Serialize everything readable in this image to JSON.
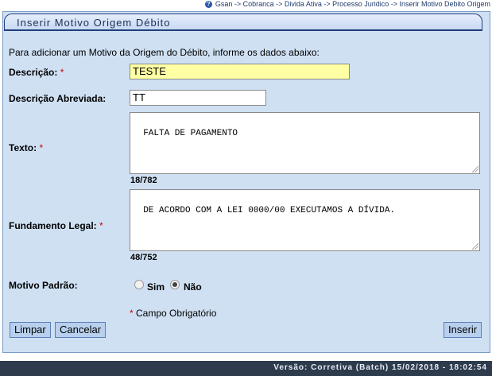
{
  "breadcrumb": "Gsan -> Cobranca -> Divida Ativa -> Processo Juridico -> Inserir Motivo Debito Origem",
  "panel": {
    "title": "Inserir Motivo Origem Débito",
    "intro": "Para adicionar um Motivo da Origem do Débito, informe os dados abaixo:"
  },
  "form": {
    "descricao_label": "Descrição:",
    "descricao_value": "TESTE",
    "descricao_abrev_label": "Descrição Abreviada:",
    "descricao_abrev_value": "TT",
    "texto_label": "Texto:",
    "texto_value": "FALTA DE PAGAMENTO",
    "texto_counter": "18/782",
    "fundamento_label": "Fundamento Legal:",
    "fundamento_value": "DE ACORDO COM A LEI 0000/00 EXECUTAMOS A DÍVIDA.",
    "fundamento_counter": "48/752",
    "motivo_label": "Motivo Padrão:",
    "opt_sim": "Sim",
    "opt_nao": "Não",
    "selected": "Não",
    "required_mark": "*",
    "required_note": "Campo Obrigatório"
  },
  "buttons": {
    "limpar": "Limpar",
    "cancelar": "Cancelar",
    "inserir": "Inserir"
  },
  "footer": "Versão: Corretiva (Batch) 15/02/2018 - 18:02:54",
  "colors": {
    "panel_bg": "#cfe0f3",
    "button_bg": "#b8d0ee",
    "required": "#cc0000",
    "footer_bg": "#2e3b4d"
  }
}
